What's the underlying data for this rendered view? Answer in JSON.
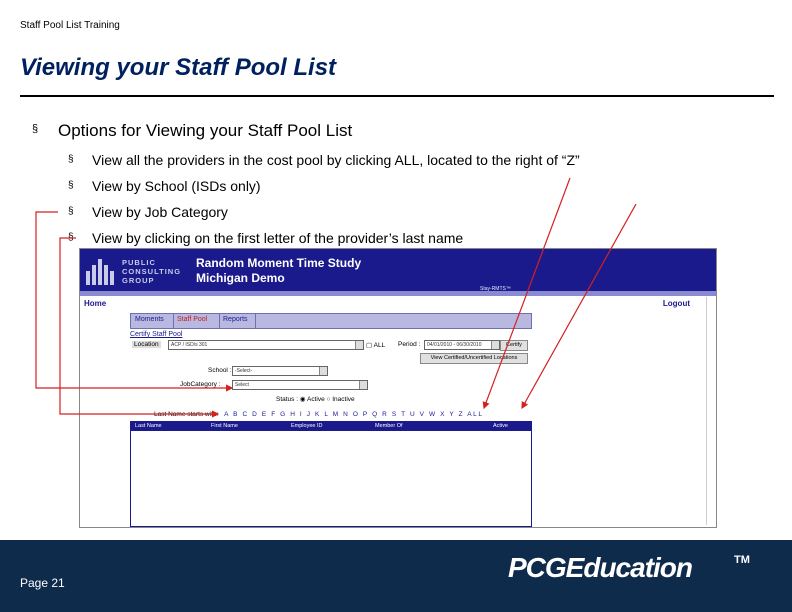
{
  "slide": {
    "header": "Staff Pool List Training",
    "title": "Viewing your Staff Pool List",
    "bullet": "Options for Viewing your Staff Pool List",
    "sub_bullets": [
      "View all the providers in the cost pool by clicking ALL, located to the right of “Z”",
      "View by School (ISDs only)",
      "View by Job Category",
      "View by clicking on the first letter of the provider’s last name"
    ],
    "bullet_marker": "§",
    "page": "Page 21",
    "brand": "PCGEducation",
    "brand_tm": "TM"
  },
  "screenshot": {
    "logo_lines": [
      "PUBLIC",
      "CONSULTING",
      "GROUP"
    ],
    "app_title": "Random Moment Time Study",
    "app_subtitle": "Michigan Demo",
    "powered_by": "Stay-RMTS™",
    "home": "Home",
    "logout": "Logout",
    "tabs": [
      "Moments",
      "Staff Pool",
      "Reports"
    ],
    "active_tab": "Staff Pool",
    "certify_link": "Certify Staff Pool",
    "location_label": "Location",
    "location_value": "ACP / ISD/s 301",
    "all_checkbox_label": "ALL",
    "period_label": "Period :",
    "period_value": "04/01/2010 - 06/30/2010",
    "certify_button": "Certify",
    "view_cert_button": "View Certified/Uncertified Locations",
    "school_label": "School :",
    "school_value": "-Select-",
    "jobcat_label": "JobCategory :",
    "jobcat_value": "Select",
    "status_label": "Status :",
    "status_active": "Active",
    "status_inactive": "Inactive",
    "lastname_label": "Last Name starts with:",
    "letters": "A B C D E F G H I J K L M N O P Q R S T U V W X Y Z ALL",
    "columns": [
      "Last Name",
      "First Name",
      "Employee ID",
      "Member Of",
      "Active"
    ]
  },
  "colors": {
    "title": "#002060",
    "banner": "#1a1a8c",
    "footer": "#0f2b4c",
    "annotation_arrow": "#d42020"
  }
}
